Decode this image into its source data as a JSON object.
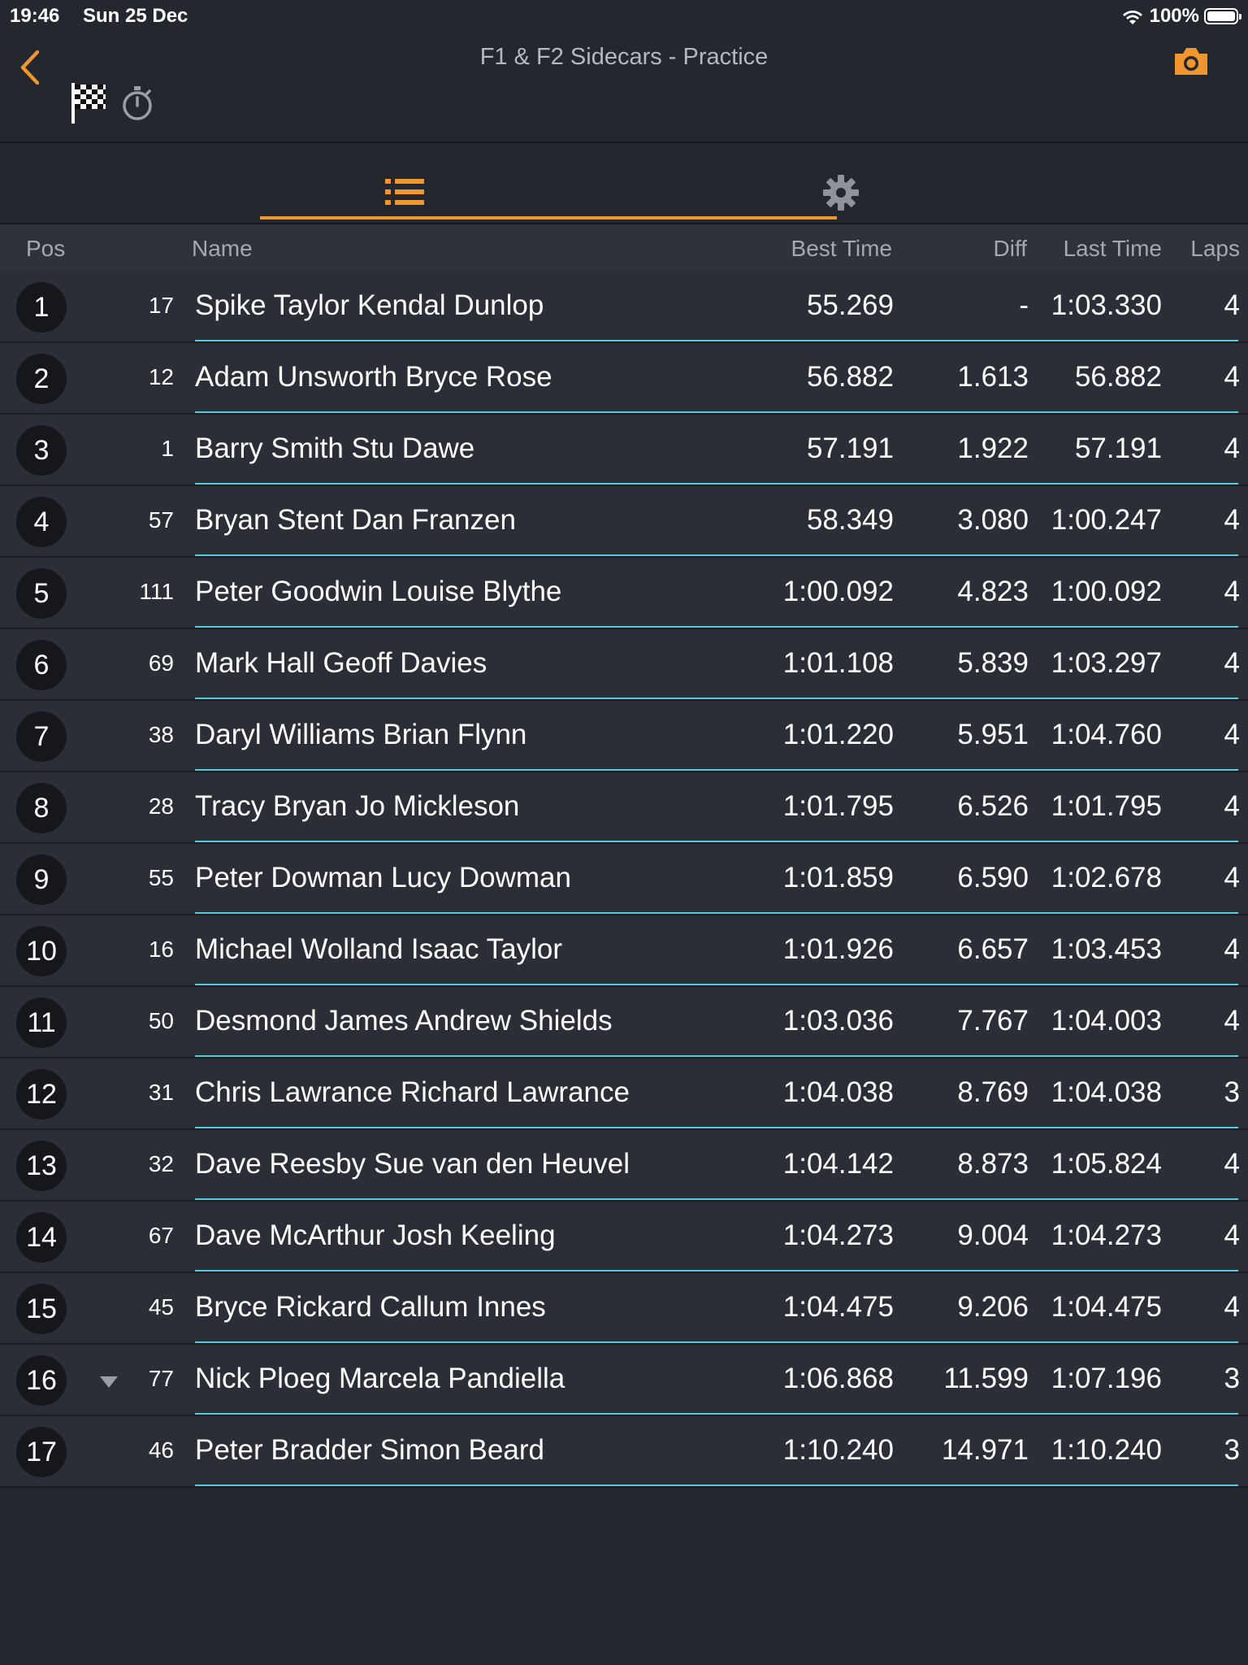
{
  "status_bar": {
    "time": "19:46",
    "date": "Sun 25 Dec",
    "battery": "100%"
  },
  "nav": {
    "title": "F1 & F2 Sidecars - Practice"
  },
  "colors": {
    "accent": "#f0962e",
    "separator": "#5cc9df",
    "background": "#24272e"
  },
  "tabs": [
    {
      "icon": "list-icon",
      "selected": true
    },
    {
      "icon": "gear-icon",
      "selected": false
    }
  ],
  "table": {
    "headers": {
      "pos": "Pos",
      "name": "Name",
      "best": "Best Time",
      "diff": "Diff",
      "last": "Last Time",
      "laps": "Laps"
    },
    "rows": [
      {
        "pos": "1",
        "num": "17",
        "name": "Spike Taylor Kendal Dunlop",
        "best": "55.269",
        "diff": "-",
        "last": "1:03.330",
        "laps": "4",
        "trend": ""
      },
      {
        "pos": "2",
        "num": "12",
        "name": "Adam Unsworth Bryce Rose",
        "best": "56.882",
        "diff": "1.613",
        "last": "56.882",
        "laps": "4",
        "trend": ""
      },
      {
        "pos": "3",
        "num": "1",
        "name": "Barry Smith Stu Dawe",
        "best": "57.191",
        "diff": "1.922",
        "last": "57.191",
        "laps": "4",
        "trend": ""
      },
      {
        "pos": "4",
        "num": "57",
        "name": "Bryan Stent Dan Franzen",
        "best": "58.349",
        "diff": "3.080",
        "last": "1:00.247",
        "laps": "4",
        "trend": ""
      },
      {
        "pos": "5",
        "num": "111",
        "name": "Peter Goodwin Louise Blythe",
        "best": "1:00.092",
        "diff": "4.823",
        "last": "1:00.092",
        "laps": "4",
        "trend": ""
      },
      {
        "pos": "6",
        "num": "69",
        "name": "Mark Hall Geoff Davies",
        "best": "1:01.108",
        "diff": "5.839",
        "last": "1:03.297",
        "laps": "4",
        "trend": ""
      },
      {
        "pos": "7",
        "num": "38",
        "name": "Daryl Williams Brian Flynn",
        "best": "1:01.220",
        "diff": "5.951",
        "last": "1:04.760",
        "laps": "4",
        "trend": ""
      },
      {
        "pos": "8",
        "num": "28",
        "name": "Tracy Bryan Jo Mickleson",
        "best": "1:01.795",
        "diff": "6.526",
        "last": "1:01.795",
        "laps": "4",
        "trend": ""
      },
      {
        "pos": "9",
        "num": "55",
        "name": "Peter Dowman Lucy Dowman",
        "best": "1:01.859",
        "diff": "6.590",
        "last": "1:02.678",
        "laps": "4",
        "trend": ""
      },
      {
        "pos": "10",
        "num": "16",
        "name": "Michael Wolland Isaac Taylor",
        "best": "1:01.926",
        "diff": "6.657",
        "last": "1:03.453",
        "laps": "4",
        "trend": ""
      },
      {
        "pos": "11",
        "num": "50",
        "name": "Desmond James Andrew Shields",
        "best": "1:03.036",
        "diff": "7.767",
        "last": "1:04.003",
        "laps": "4",
        "trend": ""
      },
      {
        "pos": "12",
        "num": "31",
        "name": "Chris Lawrance Richard Lawrance",
        "best": "1:04.038",
        "diff": "8.769",
        "last": "1:04.038",
        "laps": "3",
        "trend": ""
      },
      {
        "pos": "13",
        "num": "32",
        "name": "Dave Reesby Sue van den Heuvel",
        "best": "1:04.142",
        "diff": "8.873",
        "last": "1:05.824",
        "laps": "4",
        "trend": ""
      },
      {
        "pos": "14",
        "num": "67",
        "name": "Dave McArthur Josh Keeling",
        "best": "1:04.273",
        "diff": "9.004",
        "last": "1:04.273",
        "laps": "4",
        "trend": ""
      },
      {
        "pos": "15",
        "num": "45",
        "name": "Bryce Rickard Callum Innes",
        "best": "1:04.475",
        "diff": "9.206",
        "last": "1:04.475",
        "laps": "4",
        "trend": ""
      },
      {
        "pos": "16",
        "num": "77",
        "name": "Nick Ploeg Marcela Pandiella",
        "best": "1:06.868",
        "diff": "11.599",
        "last": "1:07.196",
        "laps": "3",
        "trend": "down"
      },
      {
        "pos": "17",
        "num": "46",
        "name": "Peter Bradder Simon Beard",
        "best": "1:10.240",
        "diff": "14.971",
        "last": "1:10.240",
        "laps": "3",
        "trend": ""
      }
    ]
  }
}
